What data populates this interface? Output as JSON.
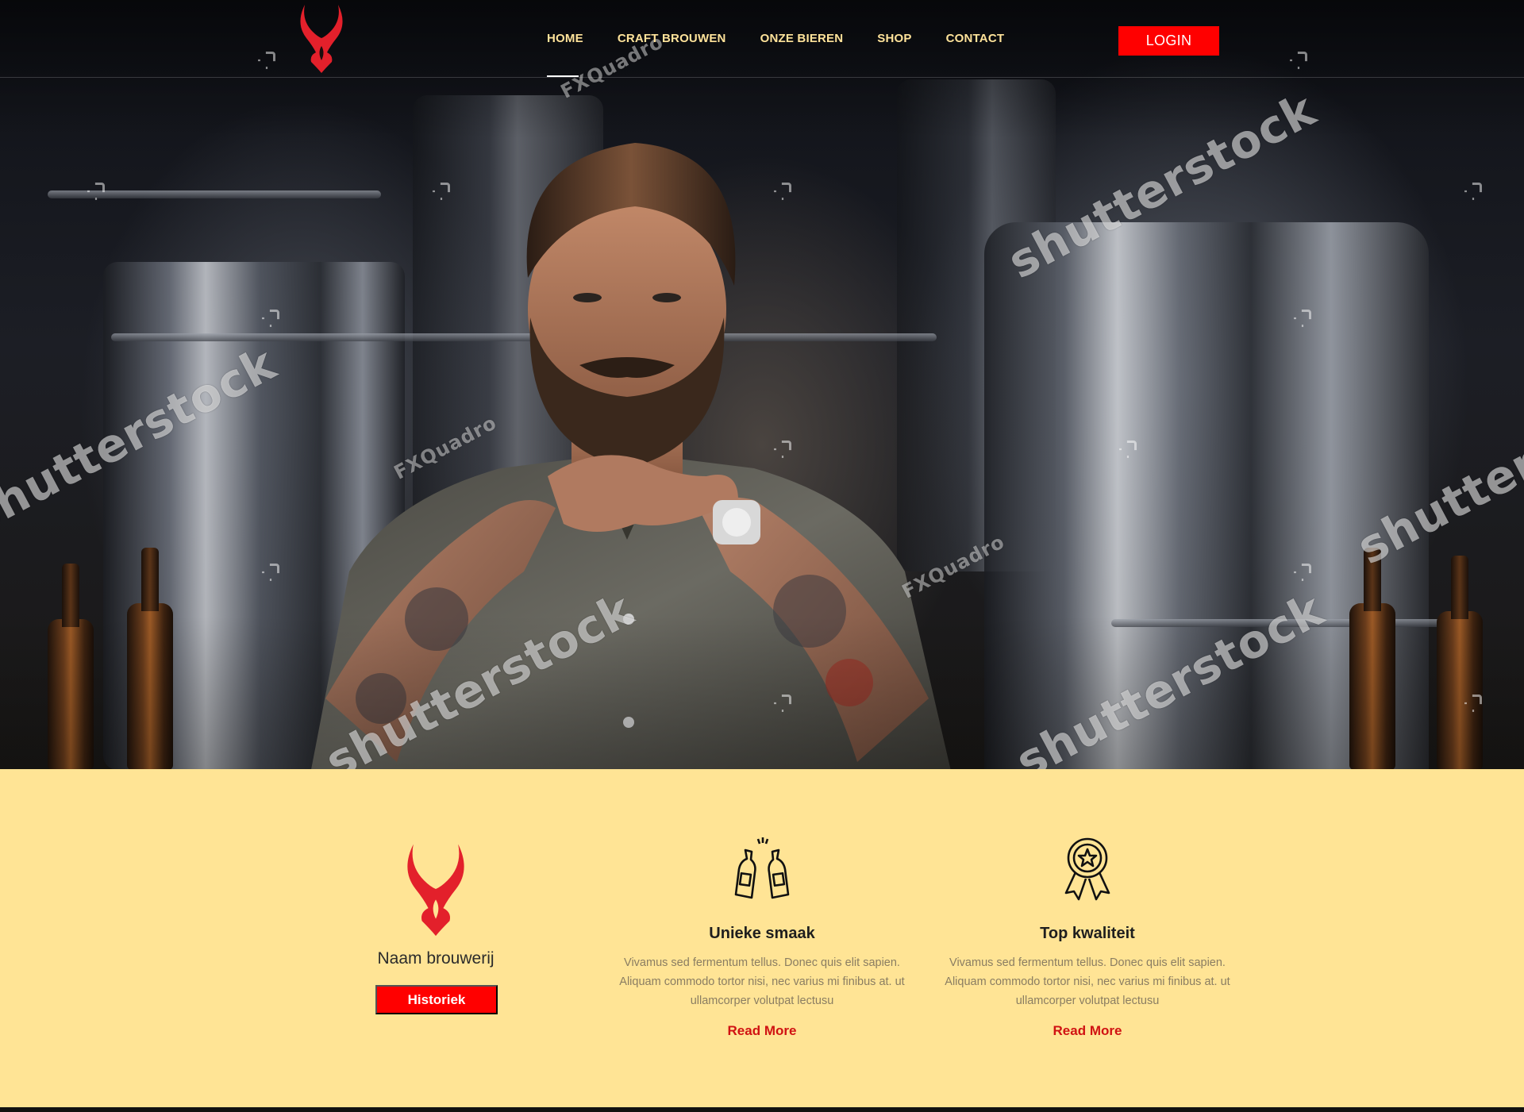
{
  "nav": {
    "logo_name": "devil-horns-logo",
    "links": [
      {
        "label": "HOME",
        "active": true
      },
      {
        "label": "CRAFT BROUWEN",
        "active": false
      },
      {
        "label": "ONZE BIEREN",
        "active": false
      },
      {
        "label": "SHOP",
        "active": false
      },
      {
        "label": "CONTACT",
        "active": false
      }
    ],
    "login_label": "LOGIN"
  },
  "hero": {
    "watermarks": [
      "shutterstock",
      "FXQuadro"
    ]
  },
  "intro": {
    "brand_name": "Naam brouwerij",
    "button_label": "Historiek"
  },
  "features": [
    {
      "icon": "beer-bottles-cheers-icon",
      "title": "Unieke smaak",
      "text": "Vivamus sed fermentum tellus. Donec quis elit sapien. Aliquam commodo tortor nisi, nec varius mi finibus at. ut ullamcorper volutpat lectusu",
      "link": "Read More"
    },
    {
      "icon": "award-badge-icon",
      "title": "Top kwaliteit",
      "text": "Vivamus sed fermentum tellus. Donec quis elit sapien. Aliquam commodo tortor nisi, nec varius mi finibus at. ut ullamcorper volutpat lectusu",
      "link": "Read More"
    }
  ],
  "colors": {
    "accent": "#ff0000",
    "nav_text": "#ffe39a",
    "feature_bg": "#ffe495",
    "link": "#d01212",
    "logo": "#e3202b"
  }
}
